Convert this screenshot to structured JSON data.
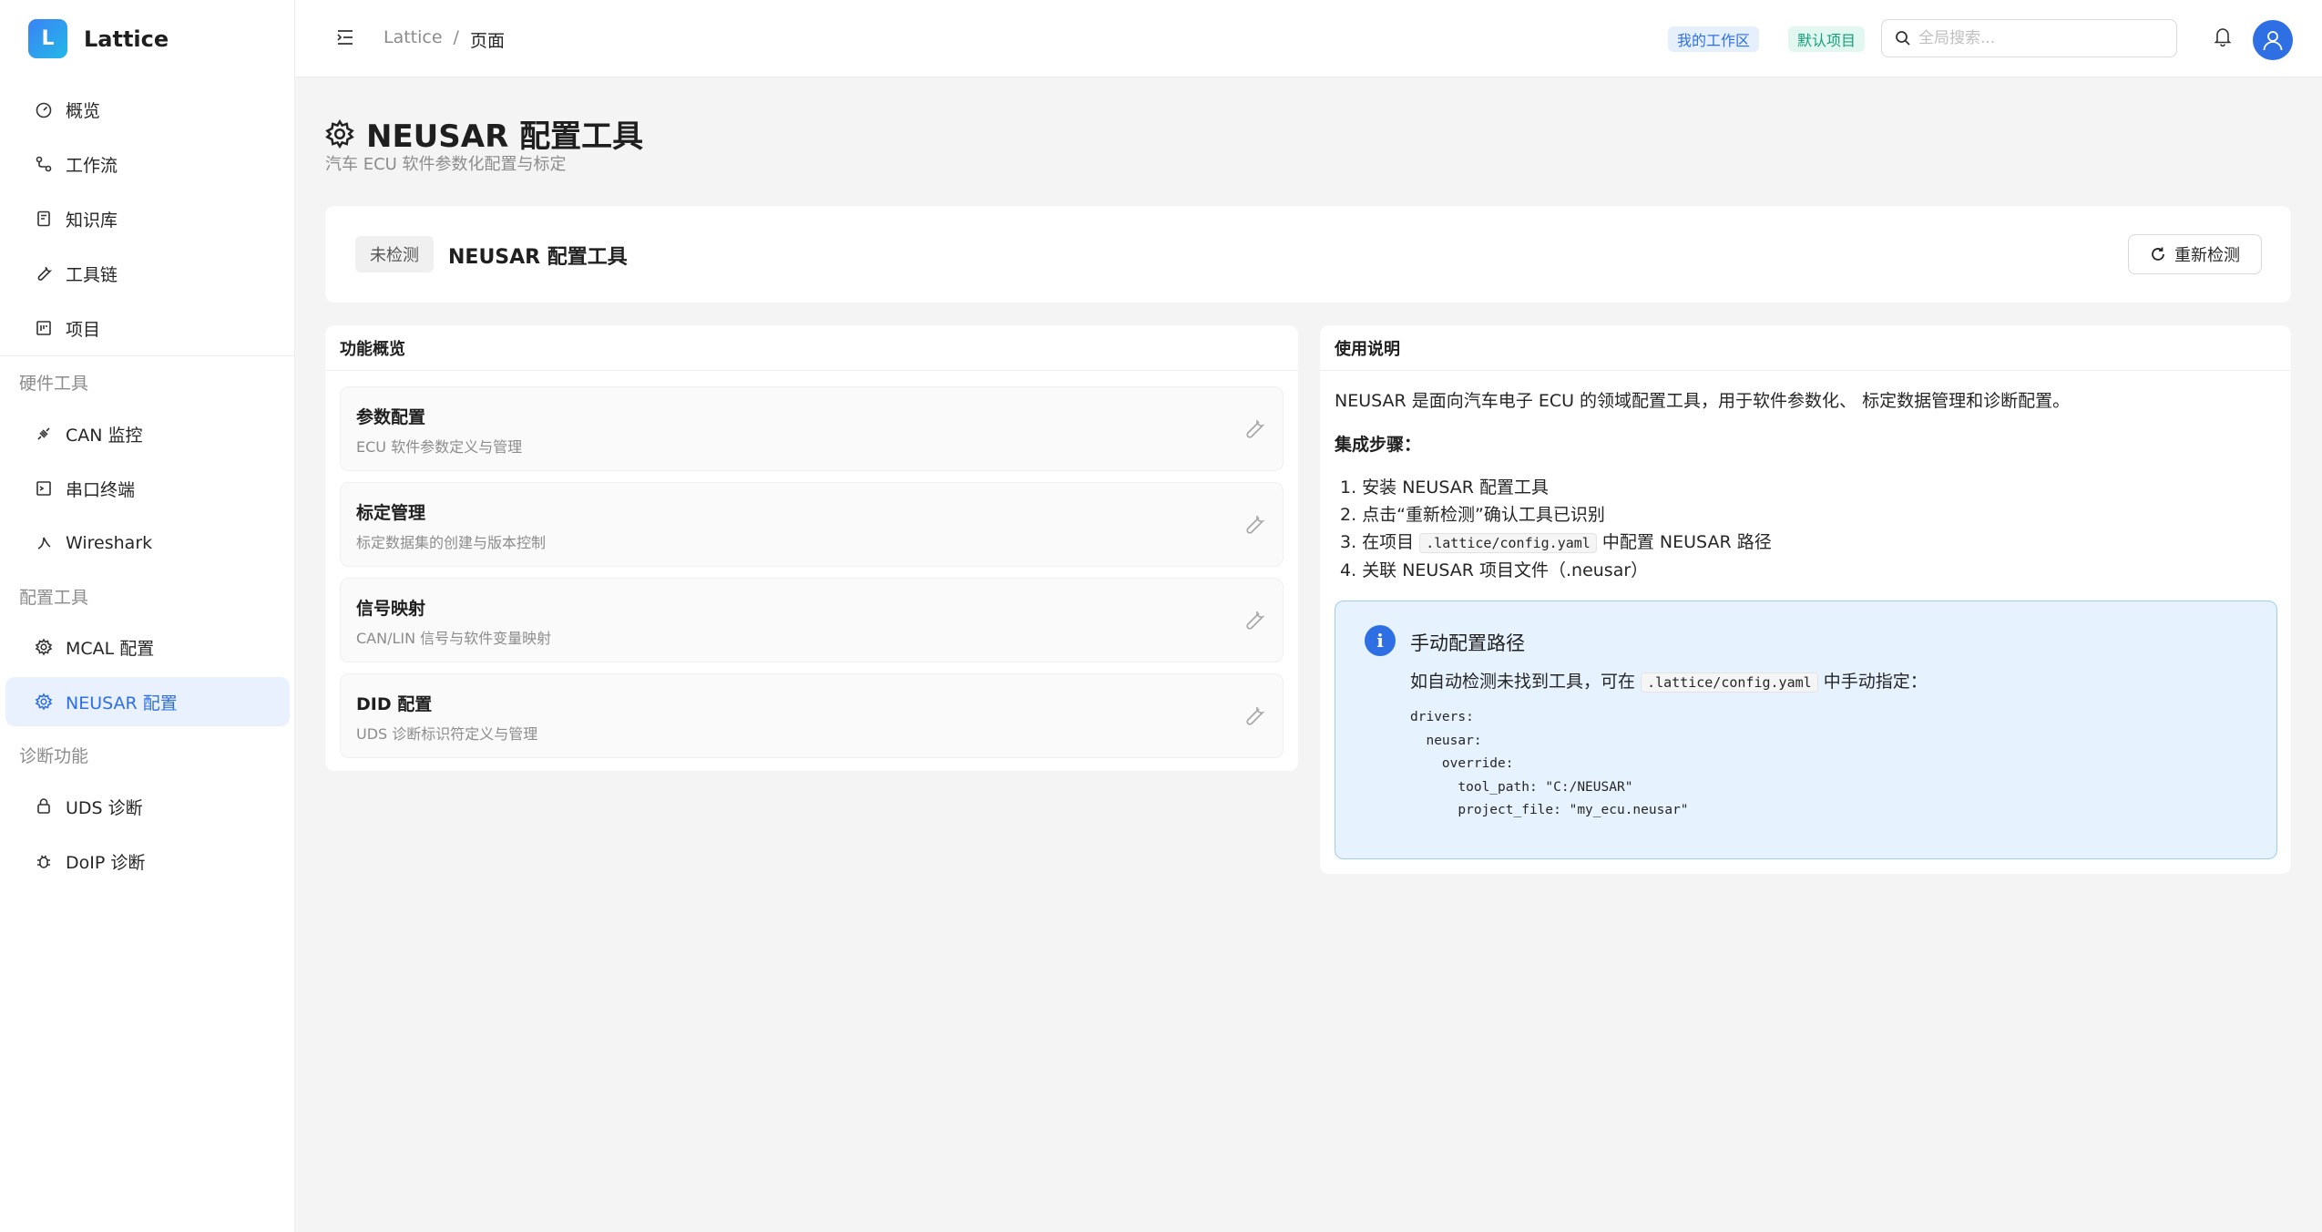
{
  "brand": {
    "logo_letter": "L",
    "name": "Lattice"
  },
  "nav": {
    "main": [
      {
        "label": "概览",
        "icon": "dashboard-icon"
      },
      {
        "label": "工作流",
        "icon": "workflow-icon"
      },
      {
        "label": "知识库",
        "icon": "book-icon"
      },
      {
        "label": "工具链",
        "icon": "wrench-icon"
      },
      {
        "label": "项目",
        "icon": "project-icon"
      }
    ],
    "sections": {
      "hardware": "硬件工具",
      "config": "配置工具",
      "diag": "诊断功能"
    },
    "hardware": [
      {
        "label": "CAN 监控",
        "icon": "plug-icon"
      },
      {
        "label": "串口终端",
        "icon": "terminal-icon"
      },
      {
        "label": "Wireshark",
        "icon": "wireshark-icon"
      }
    ],
    "config": [
      {
        "label": "MCAL 配置",
        "icon": "gear-icon"
      },
      {
        "label": "NEUSAR 配置",
        "icon": "gear-icon",
        "active": true
      }
    ],
    "diag": [
      {
        "label": "UDS 诊断",
        "icon": "lock-icon"
      },
      {
        "label": "DoIP 诊断",
        "icon": "bug-icon"
      }
    ]
  },
  "header": {
    "breadcrumb": [
      "Lattice",
      "/",
      "页面"
    ],
    "workspace_tag": "我的工作区",
    "project_tag": "默认项目",
    "search_placeholder": "全局搜索..."
  },
  "page": {
    "title": "NEUSAR 配置工具",
    "subtitle": "汽车 ECU 软件参数化配置与标定"
  },
  "status": {
    "badge": "未检测",
    "tool_name": "NEUSAR 配置工具",
    "recheck_label": "重新检测"
  },
  "features": {
    "heading": "功能概览",
    "items": [
      {
        "title": "参数配置",
        "desc": "ECU 软件参数定义与管理"
      },
      {
        "title": "标定管理",
        "desc": "标定数据集的创建与版本控制"
      },
      {
        "title": "信号映射",
        "desc": "CAN/LIN 信号与软件变量映射"
      },
      {
        "title": "DID 配置",
        "desc": "UDS 诊断标识符定义与管理"
      }
    ]
  },
  "usage": {
    "heading": "使用说明",
    "intro": "NEUSAR 是面向汽车电子 ECU 的领域配置工具，用于软件参数化、 标定数据管理和诊断配置。",
    "steps_title": "集成步骤：",
    "steps": {
      "s1": "1. 安装 NEUSAR 配置工具",
      "s2": "2. 点击“重新检测”确认工具已识别",
      "s3_pre": "3. 在项目",
      "s3_code": ".lattice/config.yaml",
      "s3_post": "中配置 NEUSAR 路径",
      "s4": "4. 关联 NEUSAR 项目文件（.neusar）"
    },
    "alert": {
      "icon": "i",
      "title": "手动配置路径",
      "text_pre": "如自动检测未找到工具，可在",
      "text_code": ".lattice/config.yaml",
      "text_post": "中手动指定：",
      "code": "drivers:\n  neusar:\n    override:\n      tool_path: \"C:/NEUSAR\"\n      project_file: \"my_ecu.neusar\""
    }
  },
  "colors": {
    "accent": "#2f6fe4",
    "active_bg": "#e8f1fd",
    "alert_bg": "#e6f2fd",
    "alert_border": "#9fcdf6"
  }
}
